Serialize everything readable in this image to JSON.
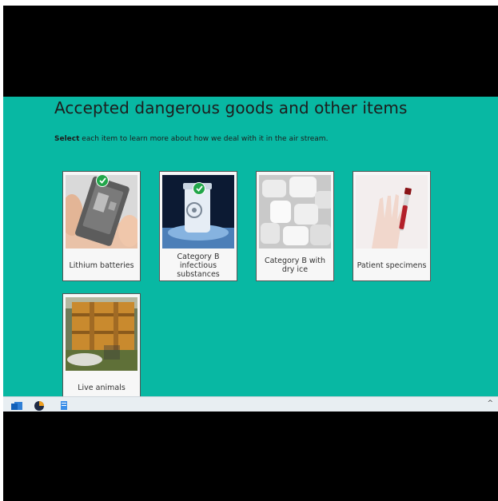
{
  "page": {
    "title": "Accepted dangerous goods and other items",
    "instruction_bold": "Select",
    "instruction_rest": " each item to learn more about how we deal with it in the air stream."
  },
  "cards": [
    {
      "label": "Lithium batteries",
      "icon": "battery-image",
      "completed": true
    },
    {
      "label": "Category B infectious substances",
      "icon": "biohazard-container-image",
      "completed": true
    },
    {
      "label": "Category B with dry ice",
      "icon": "dry-ice-image",
      "completed": false
    },
    {
      "label": "Patient specimens",
      "icon": "specimen-tube-image",
      "completed": false
    },
    {
      "label": "Live animals",
      "icon": "bee-hive-image",
      "completed": false
    }
  ],
  "colors": {
    "background": "#08b8a3",
    "check": "#22a64a",
    "card": "#f7f7f7"
  },
  "taskbar": {
    "icons": [
      "outlook-icon",
      "browser-icon",
      "notepad-icon",
      "chevron-up-icon"
    ],
    "tray_glyph": "^"
  }
}
